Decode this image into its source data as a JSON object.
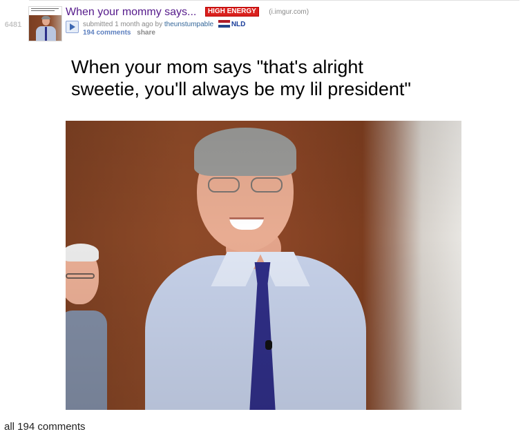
{
  "post": {
    "score": "6481",
    "title": "When your mommy says...",
    "flair": "HIGH ENERGY",
    "domain": "(i.imgur.com)",
    "submitted_prefix": "submitted 1 month ago by",
    "author": "theunstumpable",
    "author_flair": "NLD",
    "comments_label": "194 comments",
    "share_label": "share"
  },
  "meme": {
    "caption": "When your mom says \"that's alright\nsweetie, you'll always be my lil president\""
  },
  "footer": {
    "all_comments": "all 194 comments"
  },
  "colors": {
    "title_visited": "#551a8b",
    "flair_bg": "#d9211e",
    "link_blue": "#5c7fbf",
    "flag": [
      "#ae1c28",
      "#ffffff",
      "#21468b"
    ]
  },
  "icons": {
    "expando": "play-icon",
    "author_flair_icon": "netherlands-flag-icon"
  }
}
